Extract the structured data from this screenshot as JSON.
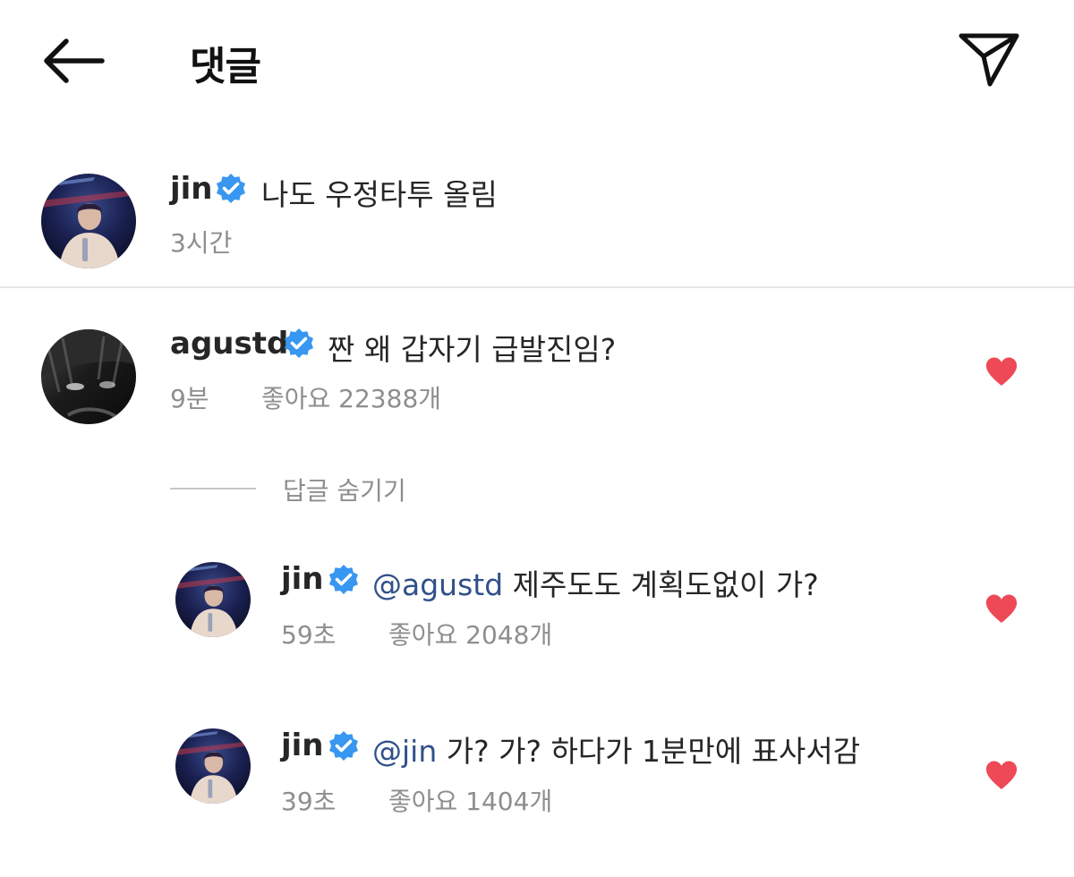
{
  "header": {
    "title": "댓글",
    "back_icon": "back-arrow-icon",
    "send_icon": "send-icon"
  },
  "caption": {
    "username": "jin",
    "text": "나도 우정타투 올림",
    "time": "3시간"
  },
  "comment": {
    "username": "agustd",
    "text": "짠 왜 갑자기 급발진임?",
    "time": "9분",
    "likes": "좋아요 22388개"
  },
  "replies_toggle": "답글 숨기기",
  "replies": [
    {
      "username": "jin",
      "mention": "@agustd",
      "text": " 제주도도 계획도없이 가?",
      "time": "59초",
      "likes": "좋아요 2048개"
    },
    {
      "username": "jin",
      "mention": "@jin",
      "text": " 가? 가? 하다가 1분만에 표사서감",
      "time": "39초",
      "likes": "좋아요 1404개"
    }
  ],
  "colors": {
    "verified": "#3897f0",
    "heart": "#ed4956",
    "mention": "#31508a",
    "meta": "#8e8e8e"
  }
}
